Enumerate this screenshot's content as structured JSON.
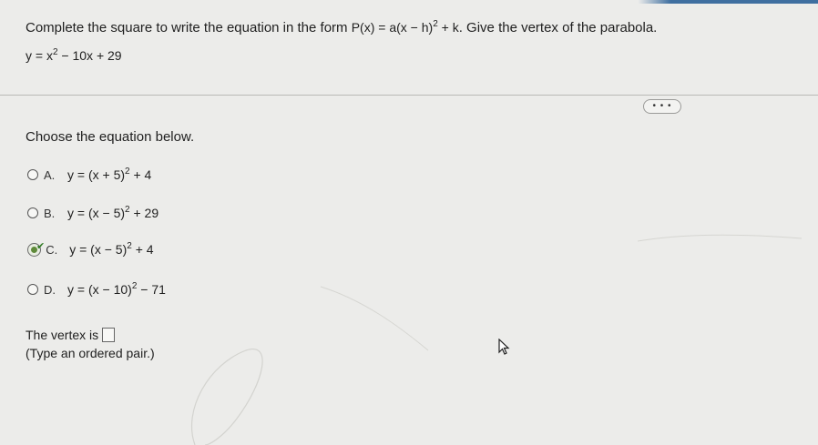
{
  "question": {
    "prefix": "Complete the square to write the equation in the form",
    "form": "P(x) = a(x − h)",
    "form_exp": "2",
    "form_tail": " + k",
    "suffix": ". Give the vertex of the parabola."
  },
  "given_equation": {
    "base": "y = x",
    "exp": "2",
    "tail": " − 10x + 29"
  },
  "more_button": "• • •",
  "prompt": "Choose the equation below.",
  "options": [
    {
      "letter": "A.",
      "base": "y = (x + 5)",
      "exp": "2",
      "tail": " + 4",
      "selected": false
    },
    {
      "letter": "B.",
      "base": "y = (x − 5)",
      "exp": "2",
      "tail": " + 29",
      "selected": false
    },
    {
      "letter": "C.",
      "base": "y = (x − 5)",
      "exp": "2",
      "tail": " + 4",
      "selected": true
    },
    {
      "letter": "D.",
      "base": "y = (x − 10)",
      "exp": "2",
      "tail": " − 71",
      "selected": false
    }
  ],
  "vertex_label": "The vertex is",
  "vertex_hint": "(Type an ordered pair.)",
  "colors": {
    "accent": "#3f6fa0",
    "check": "#2f7a22",
    "background": "#ececea"
  },
  "icons": [
    "radio-icon",
    "check-icon",
    "cursor-icon"
  ]
}
